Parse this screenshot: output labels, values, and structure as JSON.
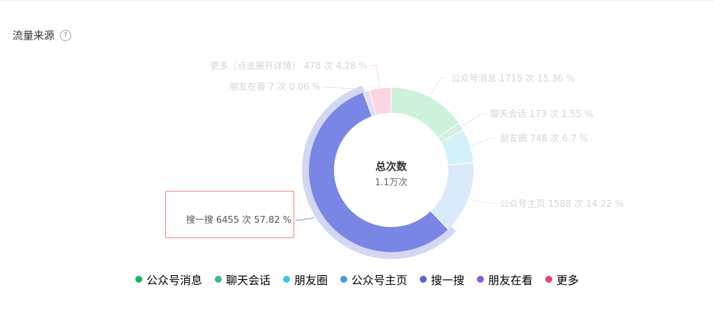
{
  "section": {
    "title": "流量来源",
    "help_glyph": "?"
  },
  "chart_data": {
    "type": "pie",
    "donut": true,
    "center": {
      "title": "总次数",
      "value": "1.1万次"
    },
    "total": 11164,
    "highlighted_slice": "搜一搜",
    "slices": [
      {
        "name": "公众号消息",
        "count": 1715,
        "percent": 15.36,
        "label": "公众号消息 1715 次 15.36 %",
        "color": "#cdf2dc",
        "legend_color": "#17b85c"
      },
      {
        "name": "聊天会话",
        "count": 173,
        "percent": 1.55,
        "label": "聊天会话 173 次 1.55 %",
        "color": "#d4eee3",
        "legend_color": "#3bb88c"
      },
      {
        "name": "朋友圈",
        "count": 748,
        "percent": 6.7,
        "label": "朋友圈 748 次 6.7 %",
        "color": "#d4f1f9",
        "legend_color": "#3ec8e6"
      },
      {
        "name": "公众号主页",
        "count": 1588,
        "percent": 14.22,
        "label": "公众号主页 1588 次 14.22 %",
        "color": "#dbeafa",
        "legend_color": "#4a9ce8"
      },
      {
        "name": "搜一搜",
        "count": 6455,
        "percent": 57.82,
        "label": "搜一搜 6455 次 57.82 %",
        "color": "#7a86e6",
        "legend_color": "#5865d4"
      },
      {
        "name": "朋友在看",
        "count": 7,
        "percent": 0.06,
        "label": "朋友在看 7 次 0.06 %",
        "color": "#e6dcf5",
        "legend_color": "#8e5ad8"
      },
      {
        "name": "更多",
        "count": 478,
        "percent": 4.28,
        "label": "更多（点击展开详情） 478 次 4.28 %",
        "color": "#fbd6e2",
        "legend_color": "#ea3f7b"
      }
    ],
    "legend": [
      "公众号消息",
      "聊天会话",
      "朋友圈",
      "公众号主页",
      "搜一搜",
      "朋友在看",
      "更多"
    ],
    "legend_placement": "bottom"
  }
}
